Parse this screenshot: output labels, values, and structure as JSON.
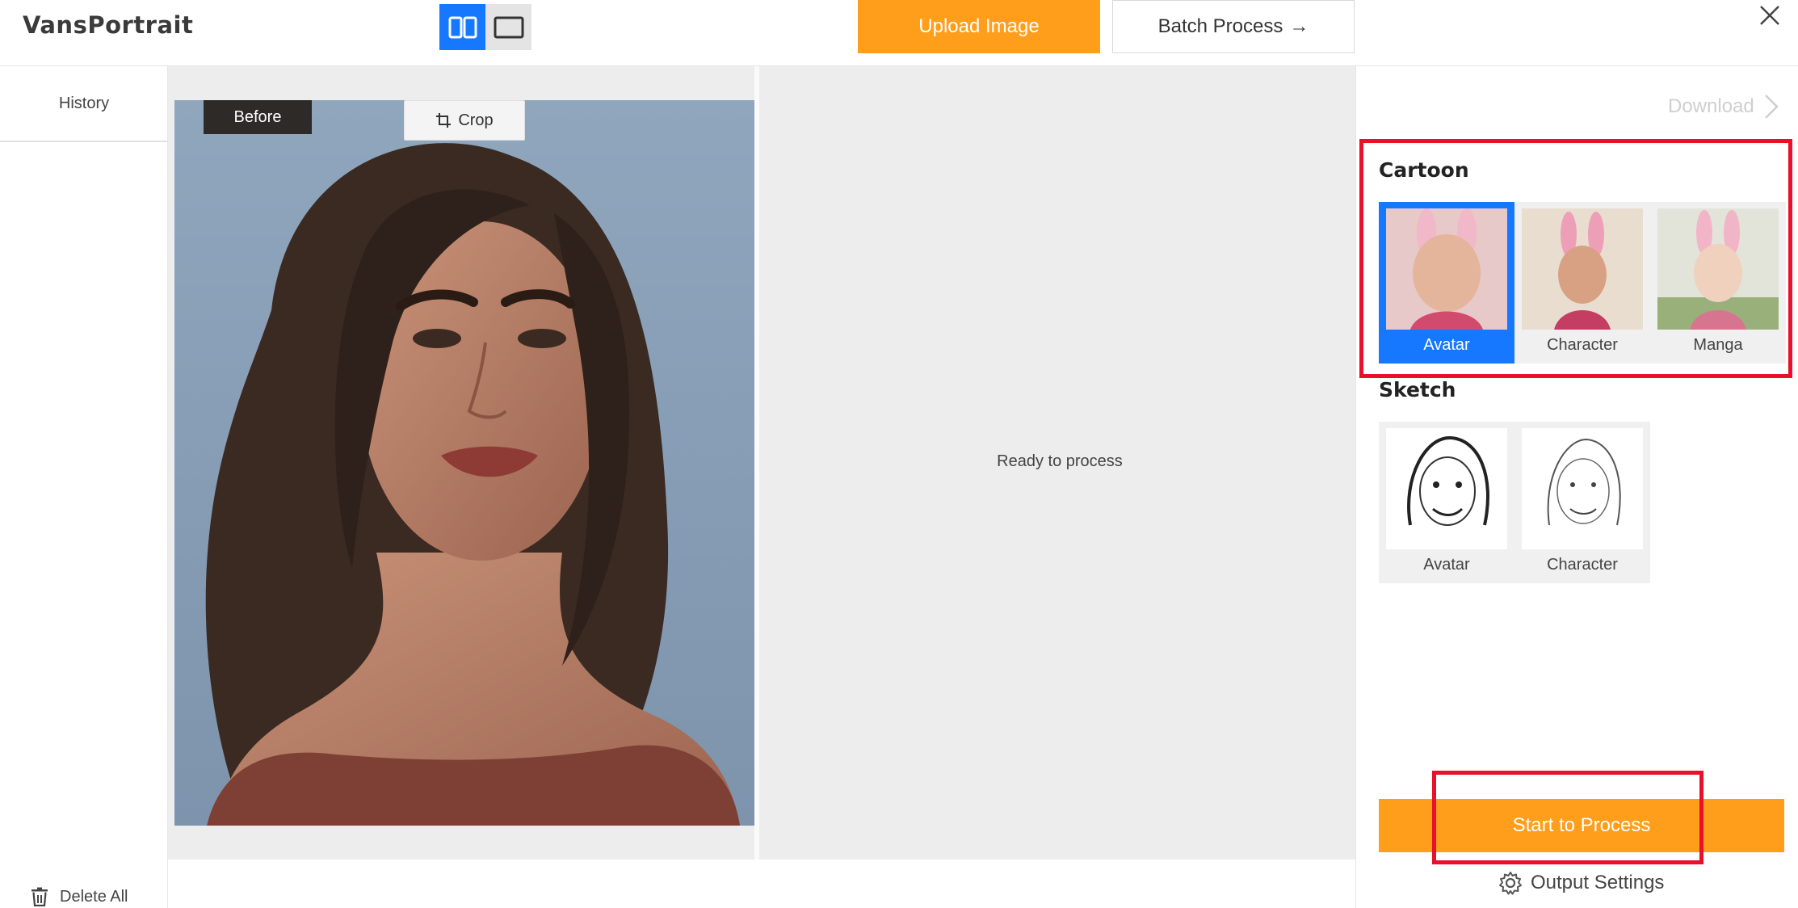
{
  "app": {
    "title": "VansPortrait"
  },
  "header": {
    "view_modes": [
      {
        "icon": "split-view-icon",
        "active": true
      },
      {
        "icon": "single-view-icon",
        "active": false
      }
    ],
    "upload_label": "Upload Image",
    "batch_label": "Batch Process",
    "batch_arrow": "→",
    "close_icon": "close-icon"
  },
  "sidebar": {
    "history_label": "History",
    "delete_all_label": "Delete All"
  },
  "workspace": {
    "before_label": "Before",
    "crop_label": "Crop",
    "status_text": "Ready to process"
  },
  "right_panel": {
    "download_label": "Download",
    "cartoon": {
      "title": "Cartoon",
      "styles": [
        {
          "label": "Avatar",
          "selected": true
        },
        {
          "label": "Character",
          "selected": false
        },
        {
          "label": "Manga",
          "selected": false
        }
      ]
    },
    "sketch": {
      "title": "Sketch",
      "styles": [
        {
          "label": "Avatar",
          "selected": false
        },
        {
          "label": "Character",
          "selected": false
        }
      ]
    },
    "process_label": "Start to Process",
    "output_settings_label": "Output Settings"
  },
  "colors": {
    "accent": "#fe9e1b",
    "selected": "#1677ff",
    "highlight": "#e8102a"
  }
}
